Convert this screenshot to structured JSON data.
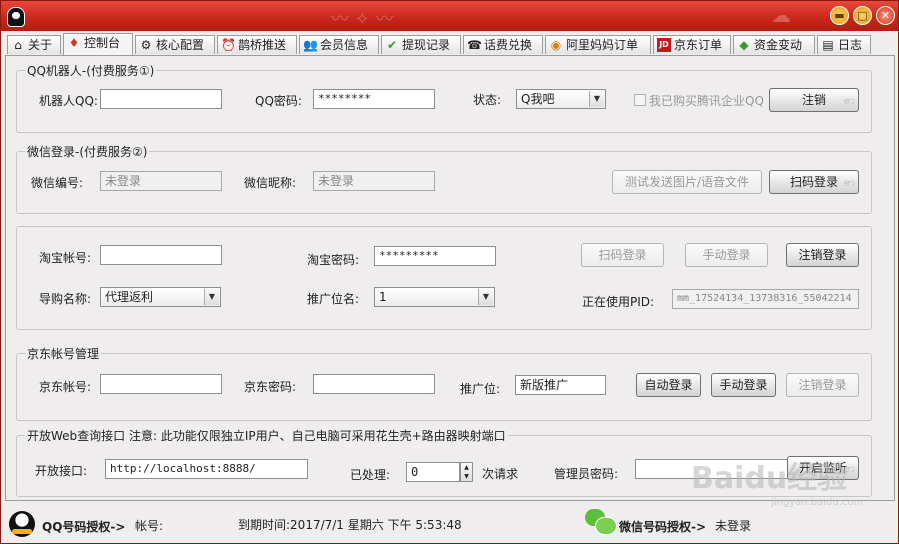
{
  "title_icons": {
    "app": "qq-penguin-icon",
    "minimize": "minimize-icon",
    "maximize": "maximize-icon",
    "close": "close-icon"
  },
  "window_buttons": {
    "minimize": "▬",
    "maximize": "□",
    "close": "✕"
  },
  "tabs": [
    {
      "label": "关于",
      "icon": "⌂"
    },
    {
      "label": "控制台",
      "icon": "♦"
    },
    {
      "label": "核心配置",
      "icon": "⚙"
    },
    {
      "label": "鹊桥推送",
      "icon": "⏰"
    },
    {
      "label": "会员信息",
      "icon": "👥"
    },
    {
      "label": "提现记录",
      "icon": "✔"
    },
    {
      "label": "话费兑换",
      "icon": "☎"
    },
    {
      "label": "阿里妈妈订单",
      "icon": "◉"
    },
    {
      "label": "京东订单",
      "icon": "JD"
    },
    {
      "label": "资金变动",
      "icon": "◆"
    },
    {
      "label": "日志",
      "icon": "▤"
    }
  ],
  "qq_group": {
    "title": "QQ机器人-(付费服务①)",
    "robot_qq_label": "机器人QQ:",
    "robot_qq_value": "",
    "password_label": "QQ密码:",
    "password_value": "********",
    "status_label": "状态:",
    "status_value": "Q我吧",
    "enterprise_label": "我已购买腾讯企业QQ",
    "logout_button": "注销"
  },
  "wechat_group": {
    "title": "微信登录-(付费服务②)",
    "id_label": "微信编号:",
    "id_value": "未登录",
    "nick_label": "微信昵称:",
    "nick_value": "未登录",
    "test_button": "测试发送图片/语音文件",
    "scan_button": "扫码登录"
  },
  "taobao_group": {
    "account_label": "淘宝帐号:",
    "account_value": "",
    "password_label": "淘宝密码:",
    "password_value": "*********",
    "scan_button": "扫码登录",
    "manual_button": "手动登录",
    "logout_button": "注销登录",
    "guide_label": "导购名称:",
    "guide_value": "代理返利",
    "position_label": "推广位名:",
    "position_value": "1",
    "pid_label": "正在使用PID:",
    "pid_value": "mm_17524134_13738316_55042214"
  },
  "jd_group": {
    "title": "京东帐号管理",
    "account_label": "京东帐号:",
    "account_value": "",
    "password_label": "京东密码:",
    "password_value": "",
    "position_label": "推广位:",
    "position_value": "新版推广",
    "auto_button": "自动登录",
    "manual_button": "手动登录",
    "logout_button": "注销登录"
  },
  "web_group": {
    "title": "开放Web查询接口  注意: 此功能仅限独立IP用户、自己电脑可采用花生壳+路由器映射端口",
    "port_label": "开放接口:",
    "port_value": "http://localhost:8888/",
    "processed_label": "已处理:",
    "processed_value": "0",
    "processed_unit": "次请求",
    "admin_label": "管理员密码:",
    "admin_value": "",
    "start_button": "开启监听"
  },
  "statusbar": {
    "qq_auth": "QQ号码授权->",
    "account_label": "帐号:",
    "expiry": "到期时间:2017/7/1 星期六 下午 5:53:48",
    "wechat_auth": "微信号码授权->",
    "wechat_status": "未登录"
  },
  "watermark": {
    "text": "Baidu经验",
    "url": "jingyan.baidu.com"
  },
  "colors": {
    "titlebar": "#c8261a",
    "accent": "#e29a17"
  }
}
